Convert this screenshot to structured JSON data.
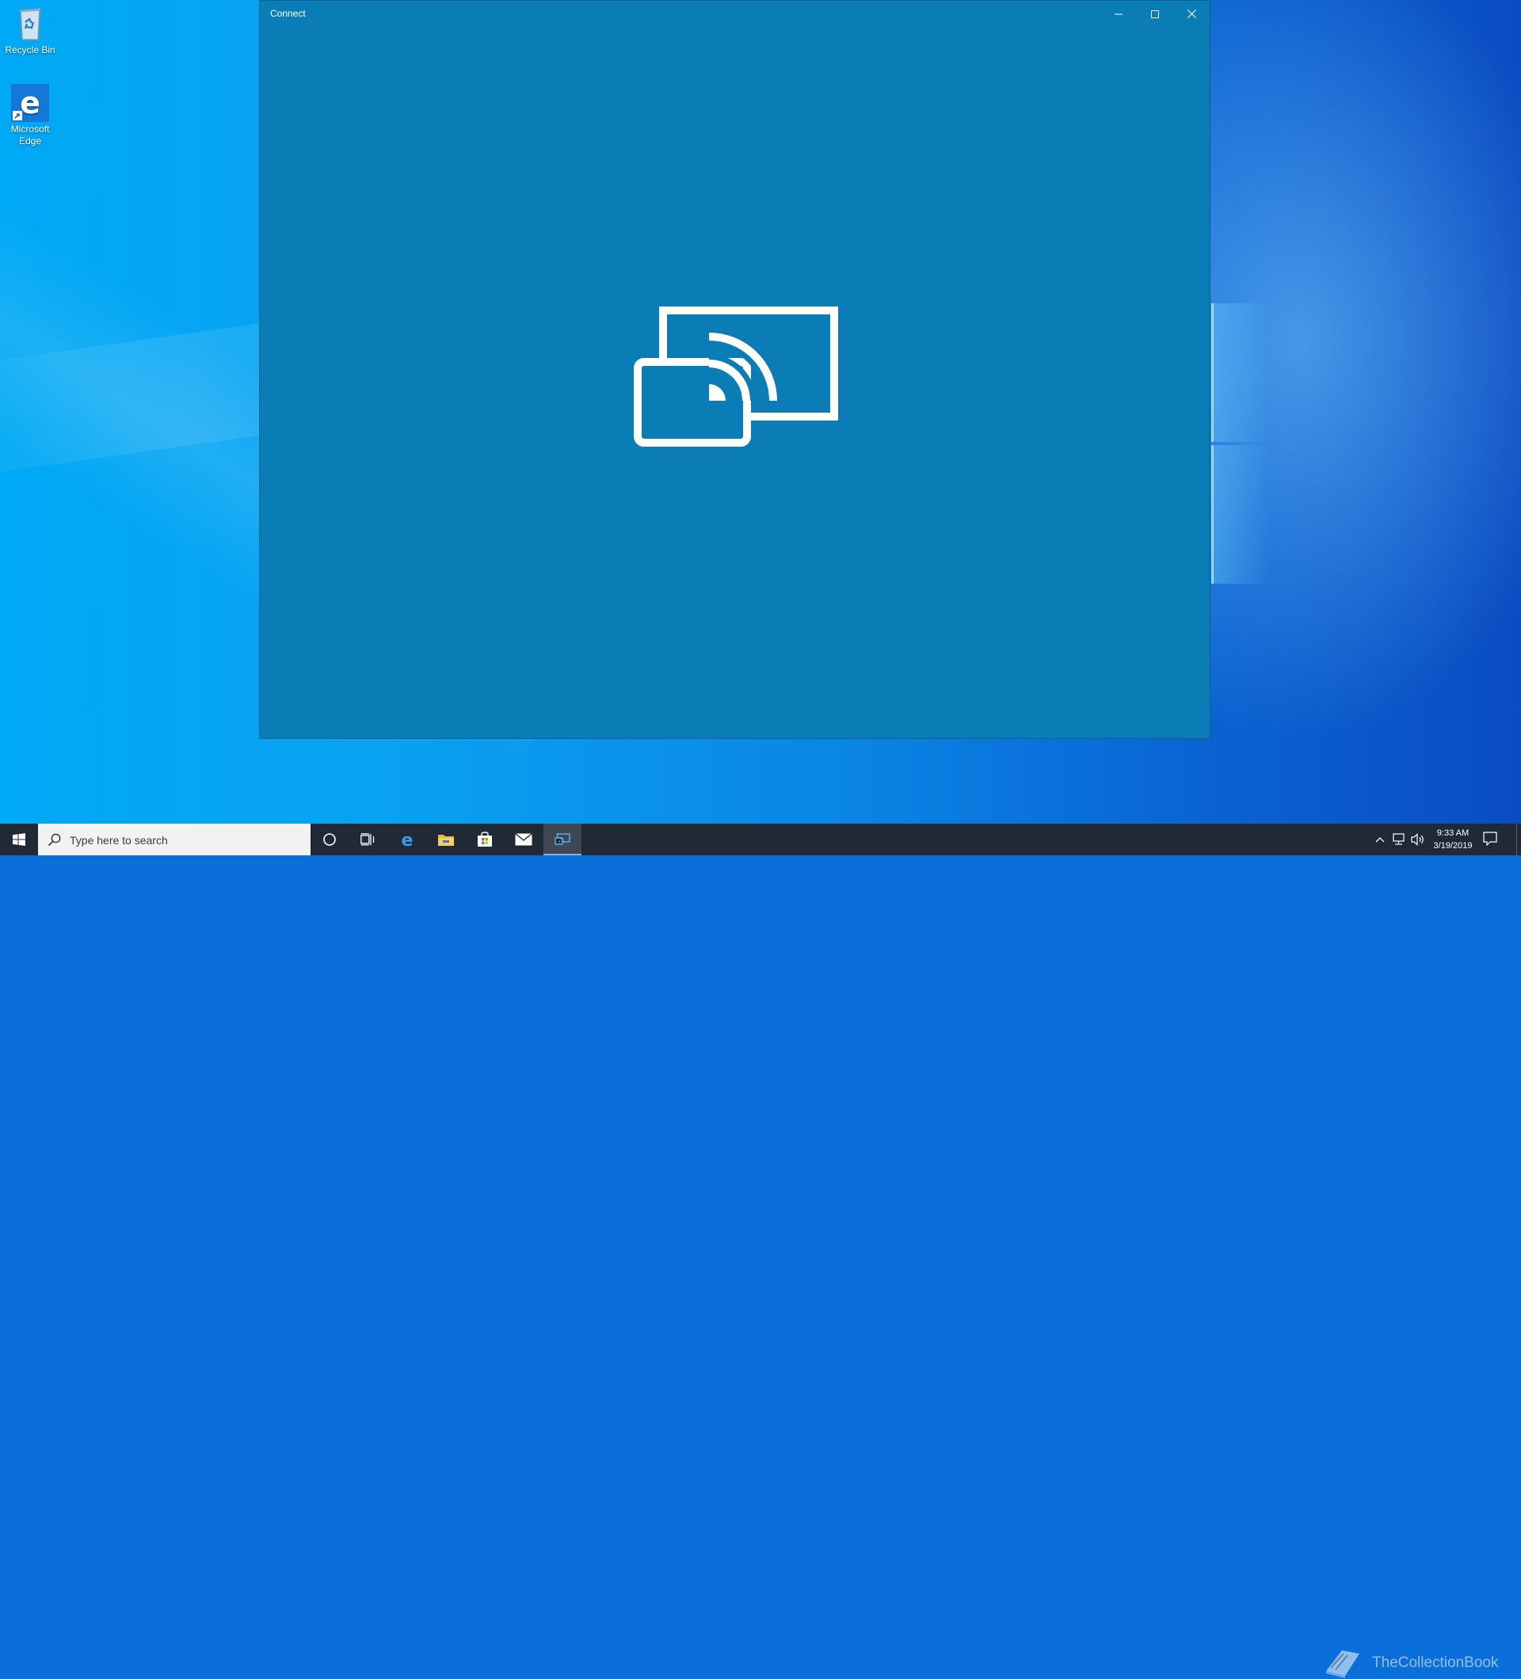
{
  "desktop": {
    "icons": [
      {
        "label": "Recycle Bin",
        "icon": "recycle-bin-icon"
      },
      {
        "label": "Microsoft Edge",
        "icon": "edge-icon"
      }
    ]
  },
  "window": {
    "title": "Connect",
    "background_color": "#0a7db7",
    "controls": [
      "minimize-icon",
      "maximize-icon",
      "close-icon"
    ],
    "graphic": "cast-display-icon"
  },
  "taskbar": {
    "search_placeholder": "Type here to search",
    "pinned": [
      "cortana-icon",
      "task-view-icon",
      "edge-icon",
      "file-explorer-icon",
      "store-icon",
      "mail-icon",
      "connect-icon"
    ],
    "active_app": "Connect"
  },
  "tray": {
    "time": "9:33 AM",
    "date": "3/19/2019",
    "icons": [
      "chevron-up-icon",
      "network-icon",
      "volume-icon",
      "notification-icon"
    ]
  },
  "watermark": {
    "text": "TheCollectionBook"
  }
}
